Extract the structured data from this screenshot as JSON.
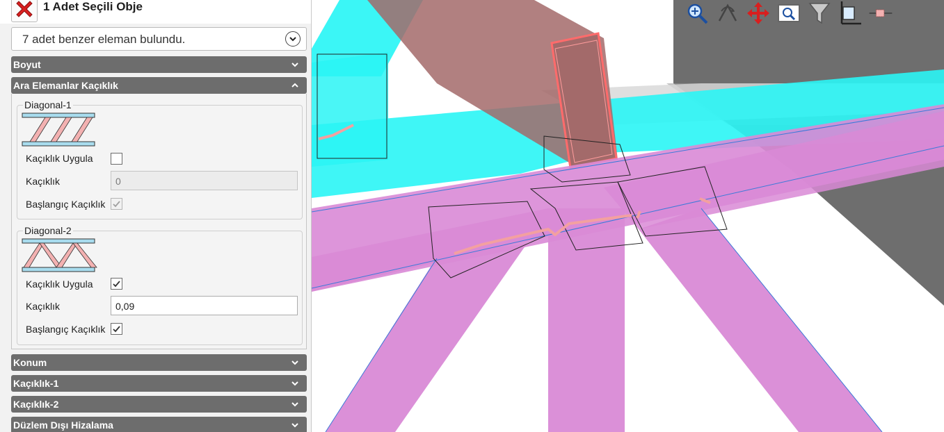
{
  "panel": {
    "title": "1 Adet Seçili Obje",
    "similar_dropdown": {
      "value": "7 adet benzer eleman bulundu."
    },
    "sections": {
      "boyut": "Boyut",
      "ara_elemanlar": "Ara Elemanlar Kaçıklık",
      "konum": "Konum",
      "kaciklik1": "Kaçıklık-1",
      "kaciklik2": "Kaçıklık-2",
      "duzlem": "Düzlem Dışı Hizalama"
    },
    "diagonal1": {
      "title": "Diagonal-1",
      "apply_label": "Kaçıklık Uygula",
      "apply_checked": false,
      "offset_label": "Kaçıklık",
      "offset_value": "0",
      "start_label": "Başlangıç Kaçıklık",
      "start_checked": true
    },
    "diagonal2": {
      "title": "Diagonal-2",
      "apply_label": "Kaçıklık Uygula",
      "apply_checked": true,
      "offset_label": "Kaçıklık",
      "offset_value": "0,09",
      "start_label": "Başlangıç Kaçıklık",
      "start_checked": true
    }
  },
  "viewport": {
    "toolbar_icons": [
      "zoom-fit-icon",
      "rotate-icon",
      "pan-icon",
      "zoom-window-icon",
      "filter-icon",
      "axis-icon",
      "section-line-icon"
    ],
    "colors": {
      "cyan_member": "#2af5f5",
      "magenta_member": "#d98ad6",
      "brace_member": "#a36a6a",
      "brace_outline": "#ff6b6b",
      "gray_wall": "#6b6b6b",
      "accent_red": "#d81f1f"
    }
  }
}
